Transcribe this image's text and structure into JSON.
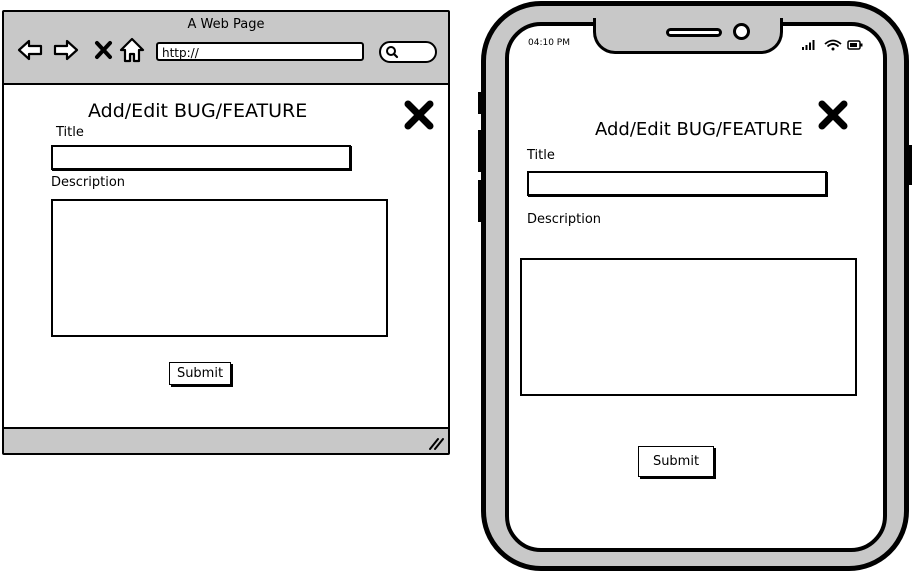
{
  "browser": {
    "window_title": "A Web Page",
    "url": "http://",
    "form": {
      "title": "Add/Edit BUG/FEATURE",
      "title_label": "Title",
      "description_label": "Description",
      "submit_label": "Submit"
    }
  },
  "phone": {
    "status_time": "04:10 PM",
    "form": {
      "title": "Add/Edit BUG/FEATURE",
      "title_label": "Title",
      "description_label": "Description",
      "submit_label": "Submit"
    }
  },
  "icons": [
    "back-arrow-icon",
    "forward-arrow-icon",
    "stop-icon",
    "home-icon",
    "search-icon",
    "resize-grip-icon",
    "close-icon",
    "signal-icon",
    "wifi-icon",
    "battery-icon"
  ],
  "colors": {
    "chrome_gray": "#c8c8c8",
    "outline": "#000000",
    "background": "#ffffff"
  }
}
